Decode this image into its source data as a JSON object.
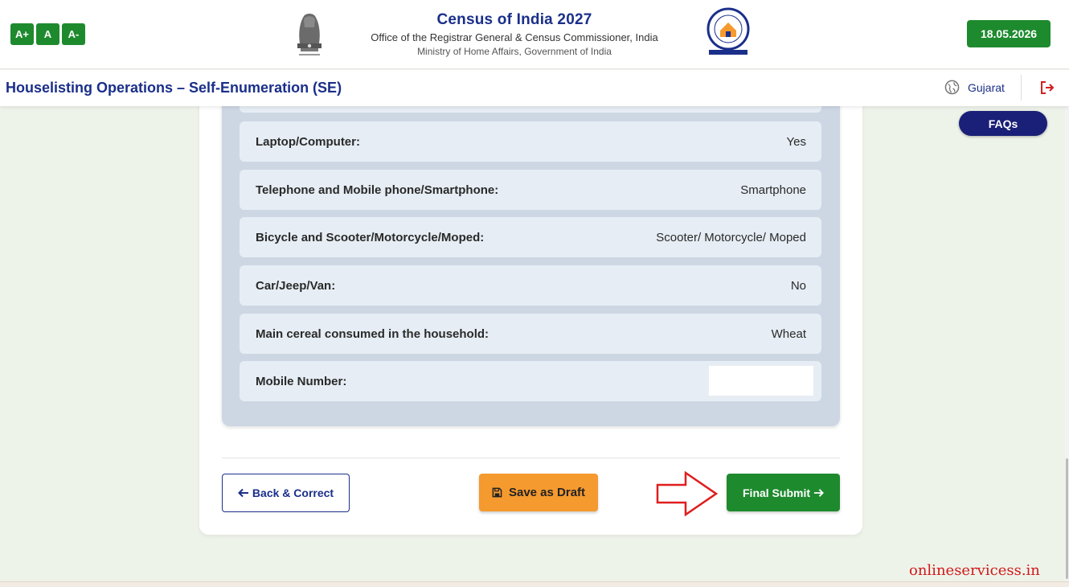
{
  "header": {
    "font_controls": [
      "A+",
      "A",
      "A-"
    ],
    "title": "Census of India 2027",
    "subtitle": "Office of the Registrar General & Census Commissioner, India",
    "ministry": "Ministry of Home Affairs, Government of India",
    "date": "18.05.2026"
  },
  "subheader": {
    "page_title": "Houselisting Operations – Self-Enumeration (SE)",
    "state": "Gujarat",
    "faqs_label": "FAQs"
  },
  "summary_rows": [
    {
      "label": "Laptop/Computer:",
      "value": "Yes"
    },
    {
      "label": "Telephone and Mobile phone/Smartphone:",
      "value": "Smartphone"
    },
    {
      "label": "Bicycle and Scooter/Motorcycle/Moped:",
      "value": "Scooter/ Motorcycle/ Moped"
    },
    {
      "label": "Car/Jeep/Van:",
      "value": "No"
    },
    {
      "label": "Main cereal consumed in the household:",
      "value": "Wheat"
    },
    {
      "label": "Mobile Number:",
      "value": ""
    }
  ],
  "actions": {
    "back_label": "Back & Correct",
    "draft_label": "Save as Draft",
    "final_label": "Final Submit"
  },
  "watermark": "onlineservicess.in",
  "colors": {
    "primary_navy": "#1a2f8a",
    "green": "#1e8a2e",
    "orange": "#f59a2f",
    "annotation_red": "#d01818"
  },
  "icons": {
    "state": "globe-icon",
    "logout": "logout-icon",
    "back": "arrow-left-icon",
    "draft": "floppy-disk-icon",
    "final": "arrow-right-icon"
  }
}
